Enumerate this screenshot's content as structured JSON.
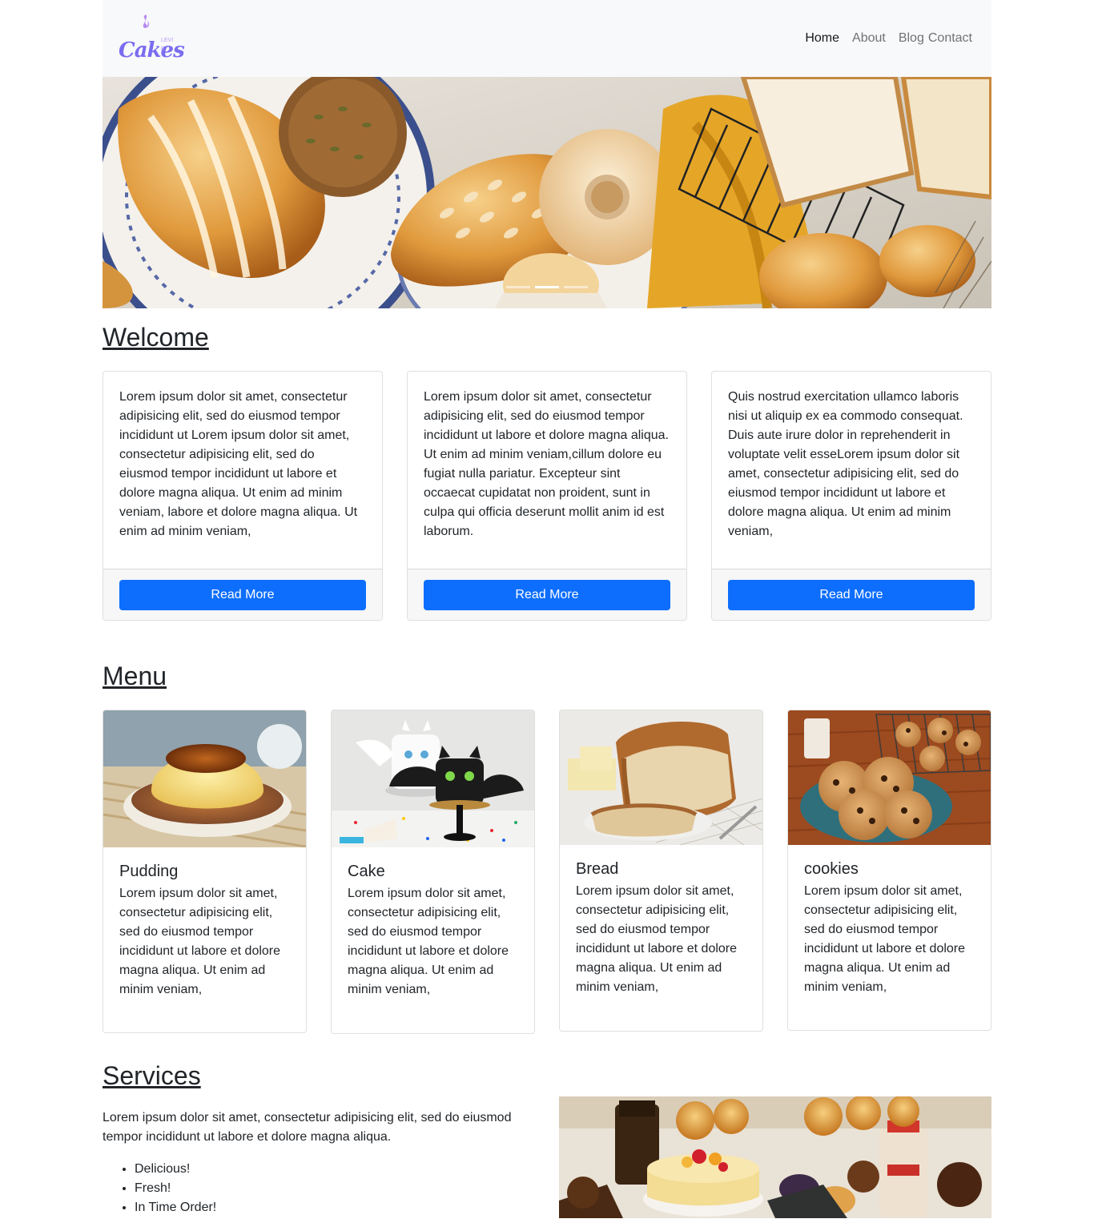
{
  "brand": {
    "logo_text": "Cakes",
    "logo_sub": "LEVI E"
  },
  "nav": {
    "home": "Home",
    "about": "About",
    "blog": "Blog",
    "contact": "Contact"
  },
  "carousel": {
    "slide_count": 3,
    "active_index": 1
  },
  "welcome": {
    "heading": "Welcome",
    "cards": [
      {
        "text": "Lorem ipsum dolor sit amet, consectetur adipisicing elit, sed do eiusmod tempor incididunt ut Lorem ipsum dolor sit amet, consectetur adipisicing elit, sed do eiusmod tempor incididunt ut labore et dolore magna aliqua. Ut enim ad minim veniam, labore et dolore magna aliqua. Ut enim ad minim veniam,",
        "button": "Read More"
      },
      {
        "text": "Lorem ipsum dolor sit amet, consectetur adipisicing elit, sed do eiusmod tempor incididunt ut labore et dolore magna aliqua. Ut enim ad minim veniam,cillum dolore eu fugiat nulla pariatur. Excepteur sint occaecat cupidatat non proident, sunt in culpa qui officia deserunt mollit anim id est laborum.",
        "button": "Read More"
      },
      {
        "text": "Quis nostrud exercitation ullamco laboris nisi ut aliquip ex ea commodo consequat. Duis aute irure dolor in reprehenderit in voluptate velit esseLorem ipsum dolor sit amet, consectetur adipisicing elit, sed do eiusmod tempor incididunt ut labore et dolore magna aliqua. Ut enim ad minim veniam,",
        "button": "Read More"
      }
    ]
  },
  "menu": {
    "heading": "Menu",
    "items": [
      {
        "title": "Pudding",
        "text": "Lorem ipsum dolor sit amet, consectetur adipisicing elit, sed do eiusmod tempor incididunt ut labore et dolore magna aliqua. Ut enim ad minim veniam,"
      },
      {
        "title": "Cake",
        "text": "Lorem ipsum dolor sit amet, consectetur adipisicing elit, sed do eiusmod tempor incididunt ut labore et dolore magna aliqua. Ut enim ad minim veniam,"
      },
      {
        "title": "Bread",
        "text": "Lorem ipsum dolor sit amet, consectetur adipisicing elit, sed do eiusmod tempor incididunt ut labore et dolore magna aliqua. Ut enim ad minim veniam,"
      },
      {
        "title": "cookies",
        "text": "Lorem ipsum dolor sit amet, consectetur adipisicing elit, sed do eiusmod tempor incididunt ut labore et dolore magna aliqua. Ut enim ad minim veniam,"
      }
    ]
  },
  "services": {
    "heading": "Services",
    "text": "Lorem ipsum dolor sit amet, consectetur adipisicing elit, sed do eiusmod tempor incididunt ut labore et dolore magna aliqua.",
    "list": [
      "Delicious!",
      "Fresh!",
      "In Time Order!"
    ]
  },
  "colors": {
    "primary": "#0d6efd",
    "navbar_bg": "#f8f9fa",
    "brand": "#7a6cf0"
  }
}
